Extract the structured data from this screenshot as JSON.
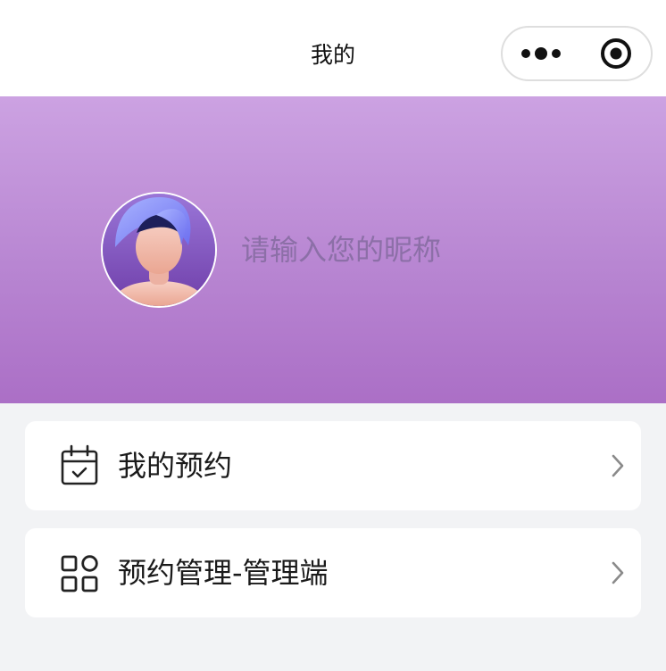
{
  "navbar": {
    "title": "我的",
    "more_icon": "more-dots-icon",
    "close_icon": "target-circle-icon"
  },
  "profile": {
    "avatar_icon": "default-avatar-icon",
    "nickname_placeholder": "请输入您的昵称",
    "nickname_value": ""
  },
  "menu": {
    "items": [
      {
        "label": "我的预约",
        "icon": "calendar-check-icon"
      },
      {
        "label": "预约管理-管理端",
        "icon": "grid-apps-icon"
      }
    ]
  },
  "colors": {
    "banner_top": "#cca2e2",
    "banner_bottom": "#ab6fc6",
    "page_background": "#f2f3f5",
    "placeholder": "#8c6fa7"
  }
}
